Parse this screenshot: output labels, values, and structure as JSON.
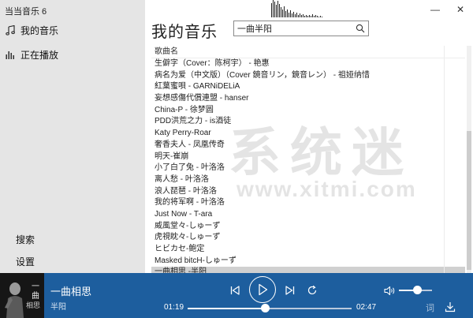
{
  "app": {
    "title": "当当音乐 6"
  },
  "sidebar": {
    "items": [
      {
        "label": "我的音乐"
      },
      {
        "label": "正在播放"
      },
      {
        "label": "搜索"
      },
      {
        "label": "设置"
      }
    ]
  },
  "header": {
    "title": "我的音乐",
    "search_value": "一曲半阳",
    "search_placeholder": ""
  },
  "window": {
    "minimize": "—",
    "close": "✕"
  },
  "song_list": {
    "column_header": "歌曲名",
    "rows": [
      "生僻字（Cover：陈柯宇） - 艳惠",
      "病名为爱（中文版）（Cover 鏡音リン，鏡音レン） - 祖娅纳惜",
      "紅葉蜜唄 - GARNiDELiA",
      "妄想感傷代償連盟 - hanser",
      "China-P - 徐梦圆",
      "PDD洪荒之力 - is酒徒",
      "Katy Perry-Roar",
      "奢香夫人 - 凤凰传奇",
      "明天-崔崩",
      "小了白了兔 - 叶洛洛",
      "离人愁 - 叶洛洛",
      "浪人琵琶 - 叶洛洛",
      "我的将军啊 - 叶洛洛",
      "Just Now - T-ara",
      "威風堂々-しゅーず",
      "虎視眈々-しゅーず",
      "ヒビカセ-鲍定",
      "Masked bitcH-しゅーず",
      "一曲相思 -半阳"
    ],
    "selected_index": 18
  },
  "watermark": {
    "cn": "系统迷",
    "en": "www.xitmi.com"
  },
  "player": {
    "title": "一曲相思",
    "artist": "半阳",
    "album_art_text": "一曲相思",
    "current_time": "01:19",
    "total_time": "02:47",
    "progress_fraction": 0.47,
    "volume_fraction": 0.55,
    "lyric_label": "词"
  },
  "colors": {
    "player_bg": "#1d5e9e",
    "sidebar_bg": "#e5e5e5",
    "selected_row": "#d0d0d0"
  }
}
